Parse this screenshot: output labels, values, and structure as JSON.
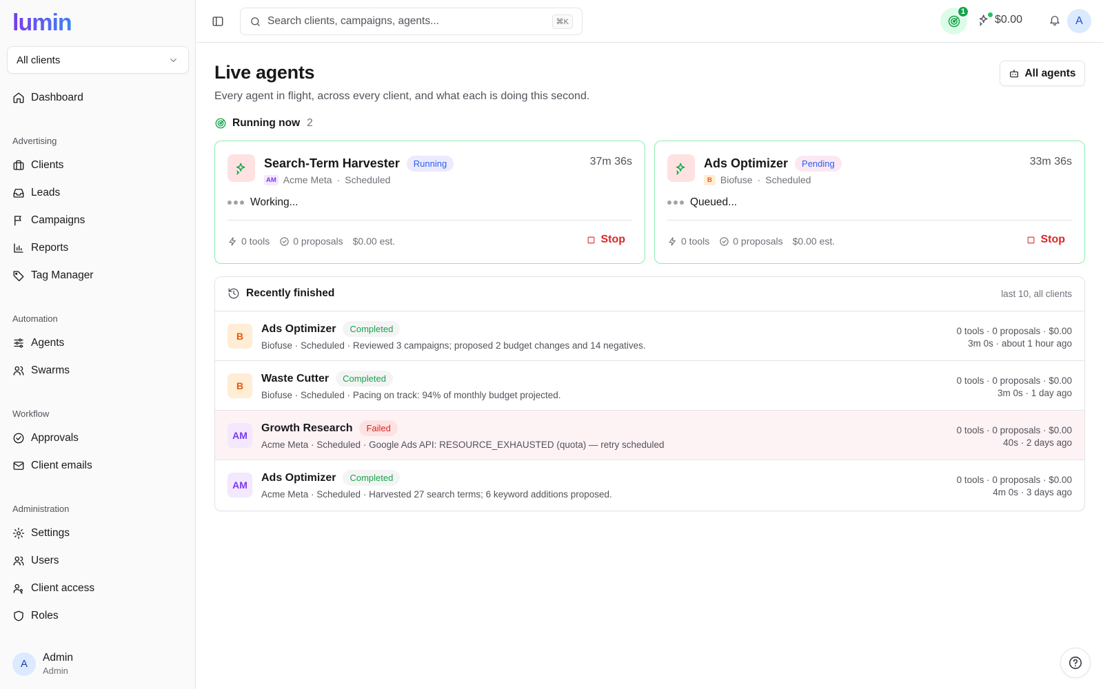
{
  "app": {
    "logo": "lumin"
  },
  "sidebar": {
    "client_select": "All clients",
    "dashboard": "Dashboard",
    "sections": {
      "advertising": "Advertising",
      "automation": "Automation",
      "workflow": "Workflow",
      "administration": "Administration"
    },
    "items": {
      "clients": "Clients",
      "leads": "Leads",
      "campaigns": "Campaigns",
      "reports": "Reports",
      "tag_manager": "Tag Manager",
      "agents": "Agents",
      "swarms": "Swarms",
      "approvals": "Approvals",
      "client_emails": "Client emails",
      "settings": "Settings",
      "users": "Users",
      "client_access": "Client access",
      "roles": "Roles"
    },
    "user": {
      "initial": "A",
      "name": "Admin",
      "role": "Admin"
    }
  },
  "header": {
    "search_placeholder": "Search clients, campaigns, agents...",
    "search_shortcut": "⌘K",
    "agents_running_count": "1",
    "spend": "$0.00",
    "user_initial": "A"
  },
  "page": {
    "title": "Live agents",
    "subtitle": "Every agent in flight, across every client, and what each is doing this second.",
    "all_agents_label": "All agents",
    "running_label": "Running now",
    "running_count": "2"
  },
  "live_agents": [
    {
      "name": "Search-Term Harvester",
      "status": "Running",
      "client_badge": "AM",
      "client": "Acme Meta",
      "trigger": "Scheduled",
      "elapsed": "37m 36s",
      "state": "Working...",
      "tools": "0 tools",
      "proposals": "0 proposals",
      "cost": "$0.00 est.",
      "stop_label": "Stop"
    },
    {
      "name": "Ads Optimizer",
      "status": "Pending",
      "client_badge": "B",
      "client": "Biofuse",
      "trigger": "Scheduled",
      "elapsed": "33m 36s",
      "state": "Queued...",
      "tools": "0 tools",
      "proposals": "0 proposals",
      "cost": "$0.00 est.",
      "stop_label": "Stop"
    }
  ],
  "recent": {
    "title": "Recently finished",
    "scope": "last 10, all clients",
    "rows": [
      {
        "badge": "B",
        "name": "Ads Optimizer",
        "status": "Completed",
        "detail": "Biofuse · Scheduled · Reviewed 3 campaigns; proposed 2 budget changes and 14 negatives.",
        "stats": "0 tools · 0 proposals · $0.00",
        "timing": "3m 0s · about 1 hour ago"
      },
      {
        "badge": "B",
        "name": "Waste Cutter",
        "status": "Completed",
        "detail": "Biofuse · Scheduled · Pacing on track: 94% of monthly budget projected.",
        "stats": "0 tools · 0 proposals · $0.00",
        "timing": "3m 0s · 1 day ago"
      },
      {
        "badge": "AM",
        "name": "Growth Research",
        "status": "Failed",
        "detail": "Acme Meta · Scheduled · Google Ads API: RESOURCE_EXHAUSTED (quota) — retry scheduled",
        "stats": "0 tools · 0 proposals · $0.00",
        "timing": "40s · 2 days ago"
      },
      {
        "badge": "AM",
        "name": "Ads Optimizer",
        "status": "Completed",
        "detail": "Acme Meta · Scheduled · Harvested 27 search terms; 6 keyword additions proposed.",
        "stats": "0 tools · 0 proposals · $0.00",
        "timing": "4m 0s · 3 days ago"
      }
    ]
  },
  "colors": {
    "brand": "#6d28d9",
    "running_border": "#86efac",
    "success": "#16a34a",
    "danger": "#dc2626",
    "info": "#2563eb"
  }
}
